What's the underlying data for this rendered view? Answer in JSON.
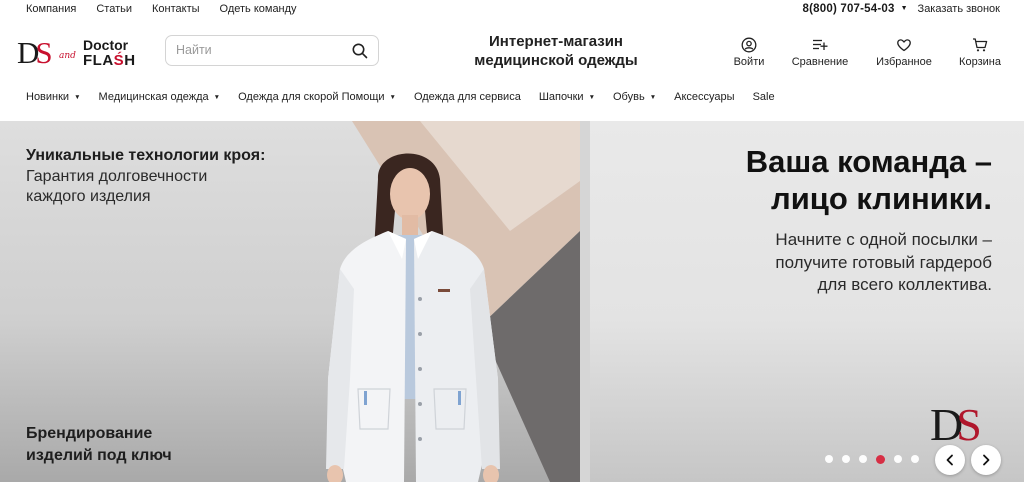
{
  "topbar": {
    "links": [
      "Компания",
      "Статьи",
      "Контакты",
      "Одеть команду"
    ],
    "phone": "8(800) 707-54-03",
    "callback": "Заказать звонок"
  },
  "header": {
    "logo": {
      "ds": "DS",
      "and": "and",
      "doctor": "Doctor",
      "flash": "FLASH"
    },
    "search_placeholder": "Найти",
    "tagline_line1": "Интернет-магазин",
    "tagline_line2": "медицинской одежды",
    "icons": {
      "login": {
        "label": "Войти",
        "icon": "user-icon"
      },
      "compare": {
        "label": "Сравнение",
        "icon": "compare-list-icon"
      },
      "favorites": {
        "label": "Избранное",
        "icon": "heart-icon"
      },
      "cart": {
        "label": "Корзина",
        "icon": "cart-icon"
      }
    }
  },
  "nav": {
    "items": [
      {
        "label": "Новинки",
        "dropdown": true
      },
      {
        "label": "Медицинская одежда",
        "dropdown": true
      },
      {
        "label": "Одежда для скорой Помощи",
        "dropdown": true
      },
      {
        "label": "Одежда для сервиса",
        "dropdown": false
      },
      {
        "label": "Шапочки",
        "dropdown": true
      },
      {
        "label": "Обувь",
        "dropdown": true
      },
      {
        "label": "Аксессуары",
        "dropdown": false
      },
      {
        "label": "Sale",
        "dropdown": false
      }
    ]
  },
  "banner": {
    "left_title": "Уникальные технологии кроя:",
    "left_sub_line1": "Гарантия долговечности",
    "left_sub_line2": "каждого изделия",
    "left_bottom_line1": "Брендирование",
    "left_bottom_line2": "изделий под ключ",
    "right_title_line1": "Ваша команда –",
    "right_title_line2": "лицо клиники.",
    "right_sub_line1": "Начните с одной посылки –",
    "right_sub_line2": "получите готовый гардероб",
    "right_sub_line3": "для всего коллектива.",
    "logo_ds": "DS",
    "slider": {
      "total": 6,
      "active_index": 3
    }
  },
  "colors": {
    "brand_red": "#c8102e",
    "active_dot": "#d7263d"
  }
}
